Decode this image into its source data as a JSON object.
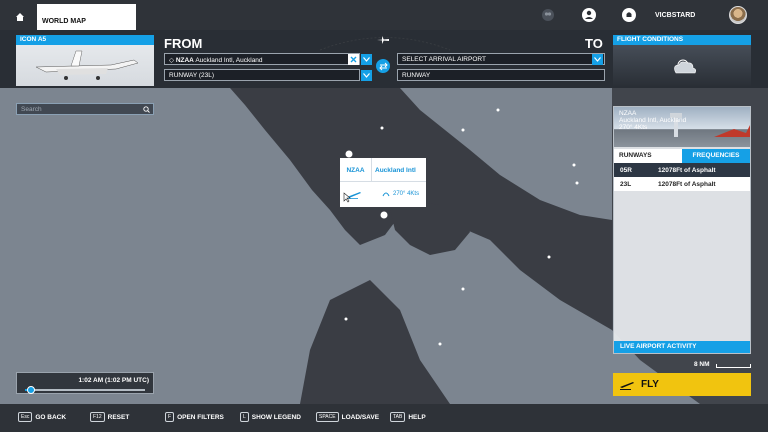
{
  "topbar": {
    "tab_label": "WORLD MAP",
    "username": "VICBSTARD"
  },
  "aircraft": {
    "label": "ICON A5"
  },
  "plan": {
    "from_label": "FROM",
    "to_label": "TO",
    "departure_code": "NZAA",
    "departure_name": "Auckland Intl, Auckland",
    "departure_runway": "RUNWAY (23L)",
    "arrival_placeholder": "SELECT ARRIVAL AIRPORT",
    "arrival_runway": "RUNWAY"
  },
  "conditions": {
    "label": "FLIGHT CONDITIONS"
  },
  "search": {
    "placeholder": "Search"
  },
  "popup": {
    "code": "NZAA",
    "name": "Auckland Intl",
    "wind": "270° 4Kts"
  },
  "airport_panel": {
    "code": "NZAA",
    "name": "Auckland Intl, Auckland",
    "wind": "270° 4Kts",
    "tab_runways": "RUNWAYS",
    "tab_frequencies": "FREQUENCIES",
    "runways": [
      {
        "id": "05R",
        "info": "12078Ft of Asphalt"
      },
      {
        "id": "23L",
        "info": "12078Ft of Asphalt"
      }
    ],
    "live_activity": "LIVE AIRPORT ACTIVITY"
  },
  "scale": {
    "label": "8 NM"
  },
  "fly": {
    "label": "FLY"
  },
  "time": {
    "text": "1:02 AM (1:02 PM UTC)",
    "position": 0.05
  },
  "bottom_hints": [
    {
      "key": "Esc",
      "label": "GO BACK"
    },
    {
      "key": "F12",
      "label": "RESET"
    },
    {
      "key": "F",
      "label": "OPEN FILTERS"
    },
    {
      "key": "L",
      "label": "SHOW LEGEND"
    },
    {
      "key": "SPACE",
      "label": "LOAD/SAVE"
    },
    {
      "key": "TAB",
      "label": "HELP"
    }
  ],
  "colors": {
    "accent": "#15a0e6",
    "fly": "#f1c40f",
    "land": "#3b3e45",
    "water": "#7c8590"
  }
}
